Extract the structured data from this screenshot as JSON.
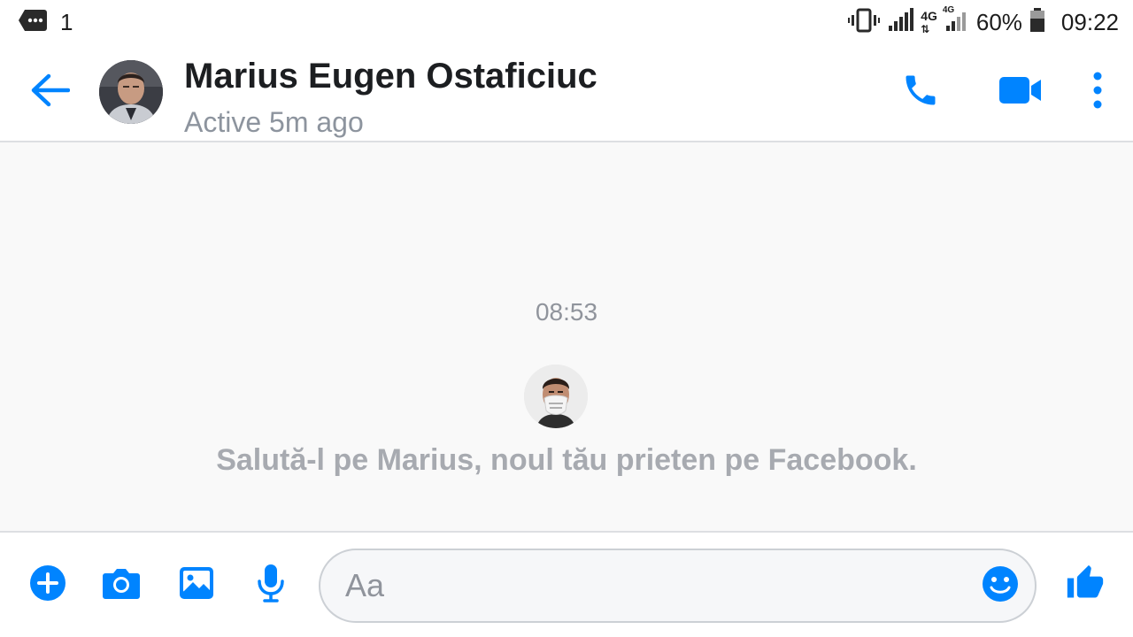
{
  "status_bar": {
    "notification_count": "1",
    "network_1": "4G",
    "network_2": "4G",
    "battery": "60%",
    "time": "09:22",
    "icons": [
      "message-notification-icon",
      "vibrate-icon",
      "signal-icon",
      "battery-icon"
    ]
  },
  "header": {
    "contact_name": "Marius Eugen Ostaficiuc",
    "status": "Active 5m ago",
    "icons": [
      "back-arrow-icon",
      "phone-icon",
      "video-camera-icon",
      "more-vertical-icon"
    ]
  },
  "conversation": {
    "timestamp": "08:53",
    "greeting": "Salută-l pe Marius, noul tău prieten pe Facebook."
  },
  "composer": {
    "placeholder": "Aa",
    "value": "",
    "icons": [
      "plus-icon",
      "camera-icon",
      "gallery-icon",
      "microphone-icon",
      "emoji-icon",
      "thumbs-up-icon"
    ]
  },
  "colors": {
    "accent": "#0084ff",
    "secondary_text": "#90949c",
    "background": "#f9f9f9"
  }
}
